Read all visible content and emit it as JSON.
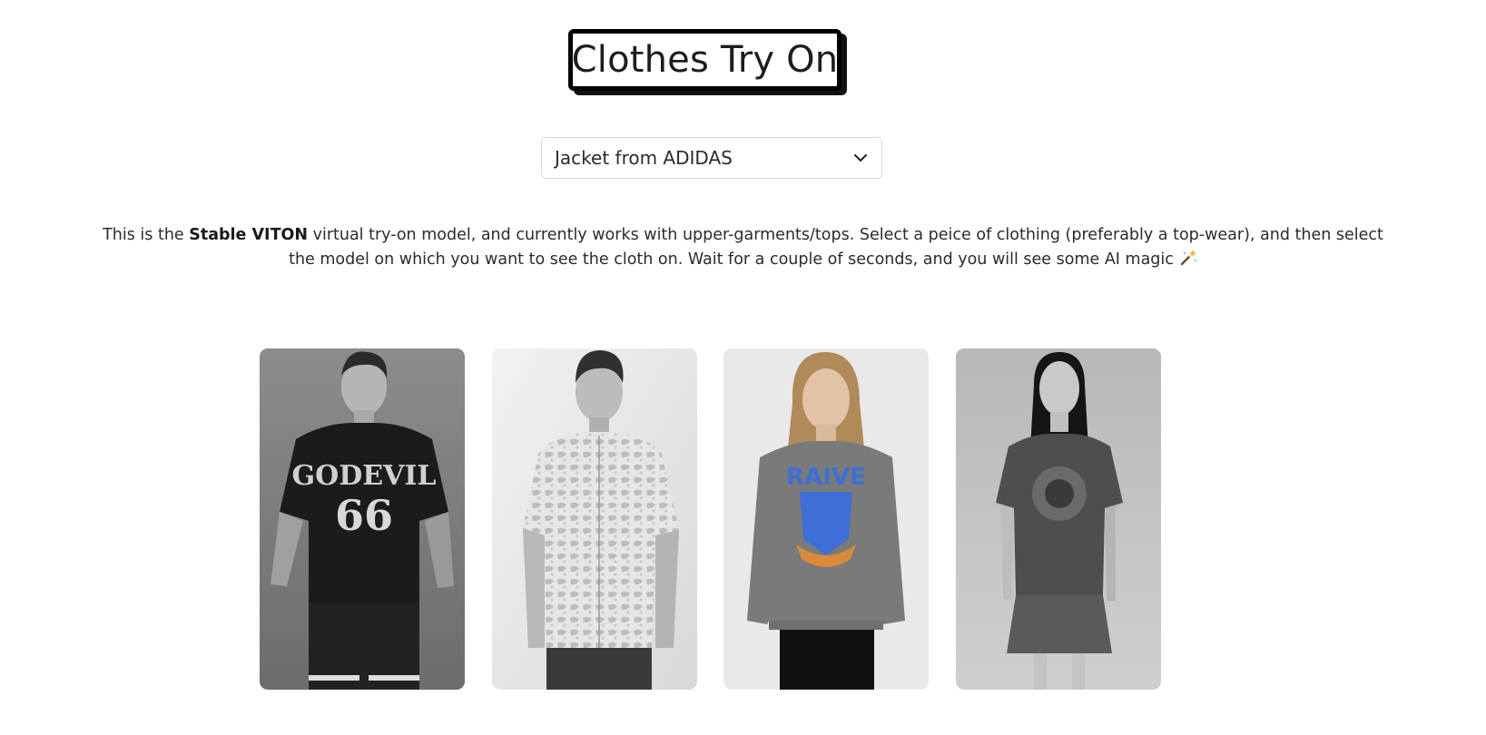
{
  "header": {
    "title": "Clothes Try On"
  },
  "garment_select": {
    "selected": "Jacket from ADIDAS",
    "icon": "chevron-down-icon"
  },
  "description": {
    "prefix": "This is the ",
    "model_name": "Stable VITON",
    "line1_rest": " virtual try-on model, and currently works with upper-garments/tops. Select a peice of clothing (preferably a top-wear), and then select",
    "line2": "the model on which you want to see the cloth on. Wait for a couple of seconds, and you will see some AI magic",
    "icon": "magic-wand-icon"
  },
  "models": [
    {
      "id": "model-1",
      "shirt_text": "GODEVIL",
      "shirt_number": "66"
    },
    {
      "id": "model-2"
    },
    {
      "id": "model-3",
      "shirt_text": "RAIVE"
    },
    {
      "id": "model-4"
    }
  ],
  "colors": {
    "title_border": "#000000",
    "text": "#2b2b2b",
    "select_border": "#d8d8d8",
    "accent_blue": "#3d6fd6"
  }
}
